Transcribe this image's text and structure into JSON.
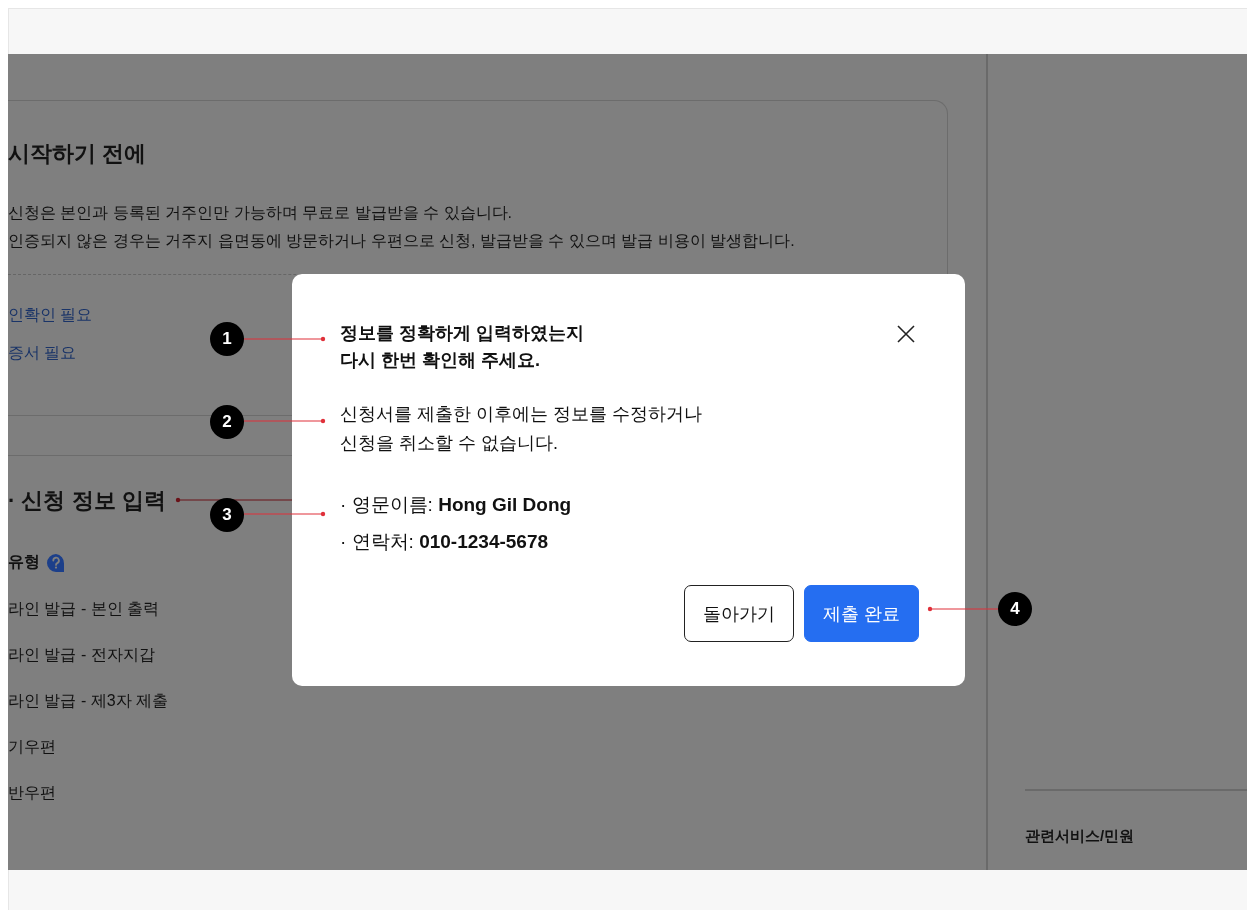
{
  "page": {
    "heading": "시작하기 전에",
    "notices": [
      "신청은 본인과 등록된 거주인만 가능하며 무료로 발급받을 수 있습니다.",
      "인증되지 않은 경우는 거주지 읍면동에 방문하거나 우편으로 신청, 발급받을 수 있으며 발급 비용이 발생합니다."
    ],
    "links": [
      "인확인 필요",
      "증서 필요"
    ],
    "section_title": "· 신청 정보 입력",
    "field_label": "유형",
    "options": [
      "라인 발급 - 본인 출력",
      "라인 발급 - 전자지갑",
      "라인 발급 - 제3자 제출",
      "기우편",
      "반우편"
    ]
  },
  "sidebar": {
    "related_title": "관련서비스/민원"
  },
  "dialog": {
    "title": "정보를 정확하게 입력하였는지\n다시 한번 확인해 주세요.",
    "message": "신청서를 제출한 이후에는 정보를 수정하거나\n신청을 취소할 수 없습니다.",
    "details": [
      "· 영문이름: **Hong Gil Dong**",
      "· 연락처: **010-1234-5678**"
    ],
    "buttons": [
      {
        "label": "돌아가기",
        "kind": "secondary"
      },
      {
        "label": "제출 완료",
        "kind": "primary"
      }
    ]
  },
  "annotations": [
    {
      "number": "1"
    },
    {
      "number": "2"
    },
    {
      "number": "3"
    },
    {
      "number": "4"
    }
  ]
}
